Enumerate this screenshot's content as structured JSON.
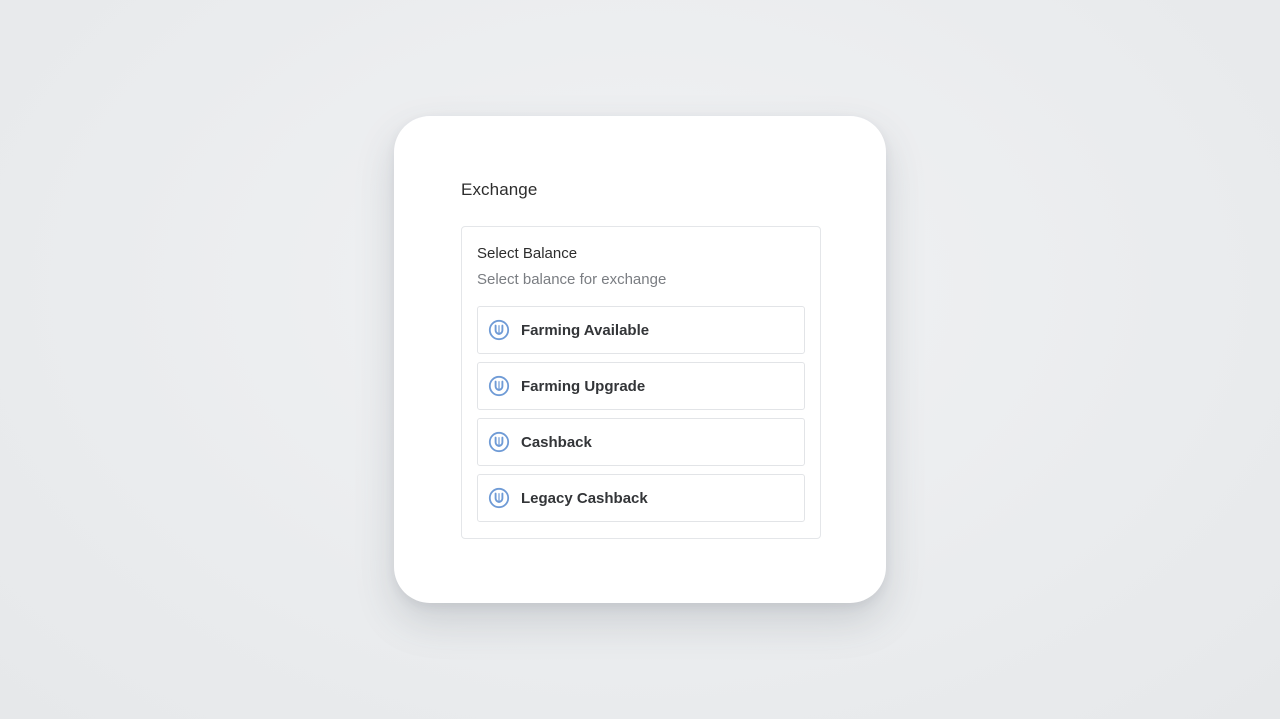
{
  "modal": {
    "title": "Exchange"
  },
  "balance_panel": {
    "title": "Select Balance",
    "subtitle": "Select balance for exchange",
    "options": [
      {
        "label": "Farming Available",
        "icon": "u-coin-icon"
      },
      {
        "label": "Farming Upgrade",
        "icon": "u-coin-icon"
      },
      {
        "label": "Cashback",
        "icon": "u-coin-icon"
      },
      {
        "label": "Legacy Cashback",
        "icon": "u-coin-icon"
      }
    ]
  },
  "colors": {
    "icon_accent": "#6f9bd6",
    "background": "#eceef0",
    "card": "#ffffff",
    "border": "#e4e6e9",
    "muted_text": "#7a7d82"
  }
}
